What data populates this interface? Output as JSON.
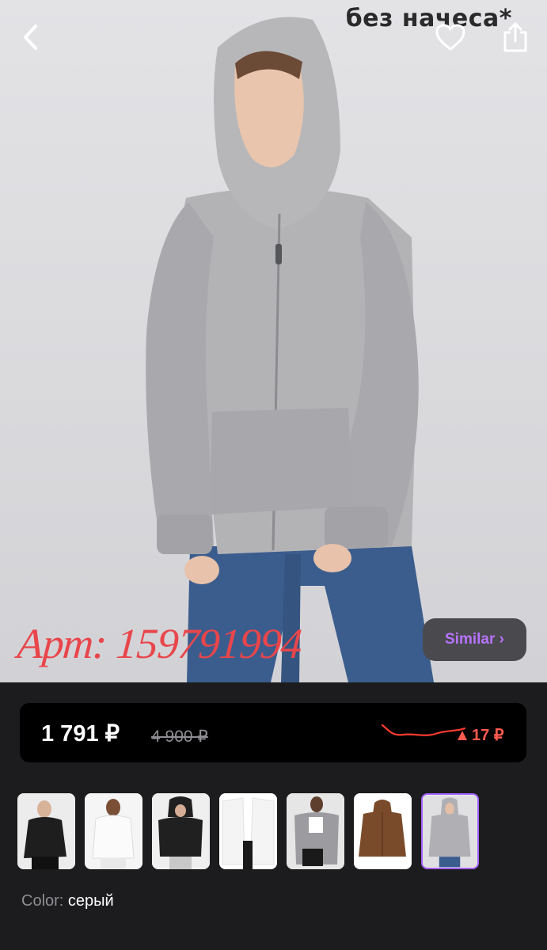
{
  "photo": {
    "caption": "без начеса*",
    "article_label": "Арт: 159791994"
  },
  "nav": {
    "back_icon": "chevron-left-icon",
    "favorite_icon": "heart-outline-icon",
    "share_icon": "share-icon"
  },
  "similar_button": {
    "label": "Similar ›",
    "color": "#b873ff"
  },
  "price": {
    "current": "1 791 ₽",
    "old": "4 900 ₽",
    "change": "17 ₽",
    "change_direction": "up",
    "change_color": "#ff5a4e"
  },
  "thumbnails": [
    {
      "name": "black-hoodie",
      "garment": "#1e1e1e",
      "selected": false
    },
    {
      "name": "white-hoodie",
      "garment": "#f2f2f2",
      "selected": false
    },
    {
      "name": "black-hoodie-hood-up",
      "garment": "#202020",
      "selected": false
    },
    {
      "name": "white-cardigan",
      "garment": "#f7f7f7",
      "selected": false
    },
    {
      "name": "grey-hoodie-open",
      "garment": "#9c9ca0",
      "selected": false
    },
    {
      "name": "brown-hoodie",
      "garment": "#7a4b2a",
      "selected": false
    },
    {
      "name": "grey-hoodie",
      "garment": "#b0b0b4",
      "selected": true
    }
  ],
  "color": {
    "label": "Color:",
    "value": "серый"
  }
}
